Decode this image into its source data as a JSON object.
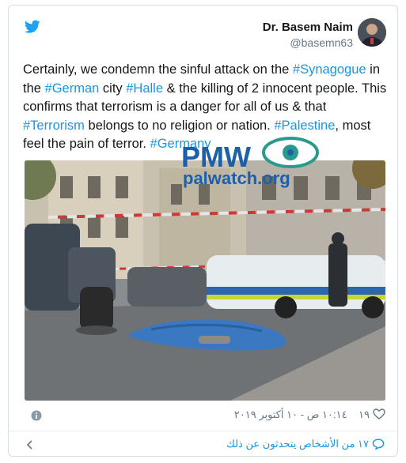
{
  "author": {
    "display_name": "Dr. Basem Naim",
    "handle": "@basemn63"
  },
  "tweet": {
    "segments": [
      {
        "text": "Certainly, we condemn the sinful attack on the ",
        "tag": false
      },
      {
        "text": "#Synagogue",
        "tag": true
      },
      {
        "text": " in the ",
        "tag": false
      },
      {
        "text": "#German",
        "tag": true
      },
      {
        "text": " city ",
        "tag": false
      },
      {
        "text": "#Halle",
        "tag": true
      },
      {
        "text": " & the killing of 2 innocent people. This confirms that terrorism is a danger for all of us & that ",
        "tag": false
      },
      {
        "text": "#Terrorism",
        "tag": true
      },
      {
        "text": " belongs to no religion or nation. ",
        "tag": false
      },
      {
        "text": "#Palestine",
        "tag": true
      },
      {
        "text": ", most feel the pain of terror. ",
        "tag": false
      },
      {
        "text": "#Germany",
        "tag": true
      }
    ]
  },
  "watermark": {
    "logo_text": "PMW",
    "site": "palwatch.org"
  },
  "meta": {
    "likes": "١٩",
    "timestamp": "١٠:١٤ ص - ١٠ أكتوبر ٢٠١٩"
  },
  "footer": {
    "talking": "١٧ من الأشخاص يتحدثون عن ذلك"
  },
  "colors": {
    "link": "#1b95e0",
    "text": "#14171a",
    "muted": "#657786",
    "border": "#d7dfe5"
  },
  "icons": [
    "twitter-bird-icon",
    "info-icon",
    "heart-icon",
    "chevron-left-icon",
    "comment-bubble-icon"
  ]
}
